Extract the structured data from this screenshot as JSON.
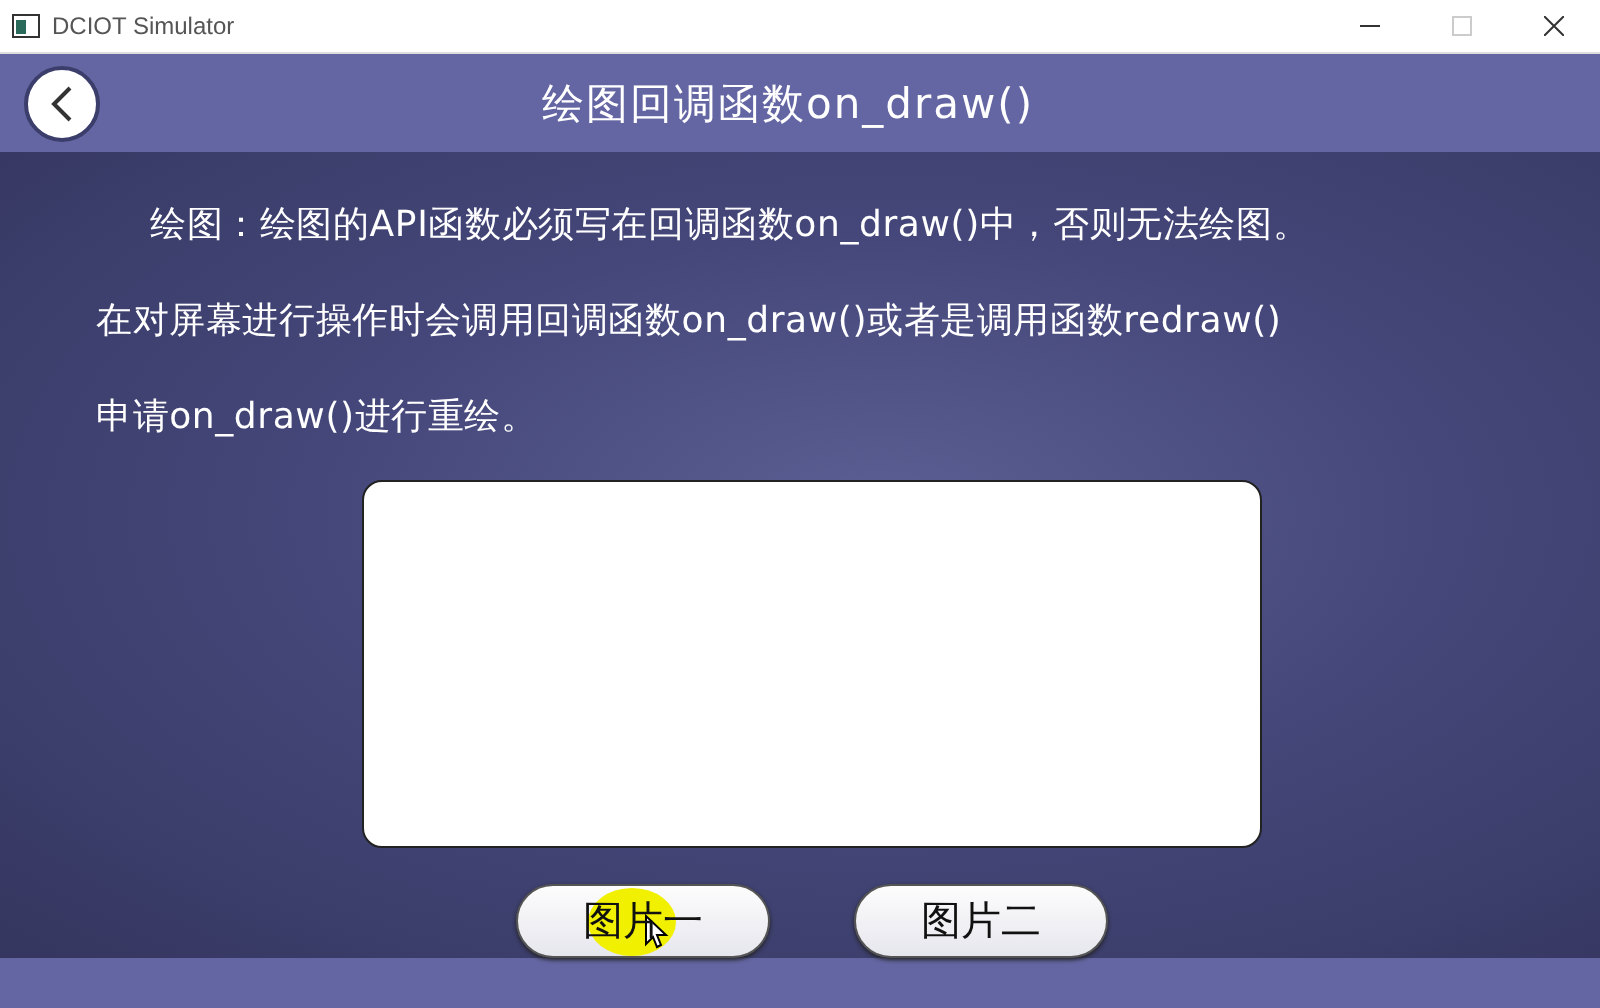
{
  "window": {
    "title": "DCIOT Simulator"
  },
  "header": {
    "title": "绘图回调函数on_draw()"
  },
  "description": {
    "lines": [
      "绘图：绘图的API函数必须写在回调函数on_draw()中，否则无法绘图。",
      "在对屏幕进行操作时会调用回调函数on_draw()或者是调用函数redraw()",
      "申请on_draw()进行重绘。"
    ]
  },
  "buttons": [
    {
      "label": "图片一",
      "hovered": true
    },
    {
      "label": "图片二",
      "hovered": false
    }
  ]
}
